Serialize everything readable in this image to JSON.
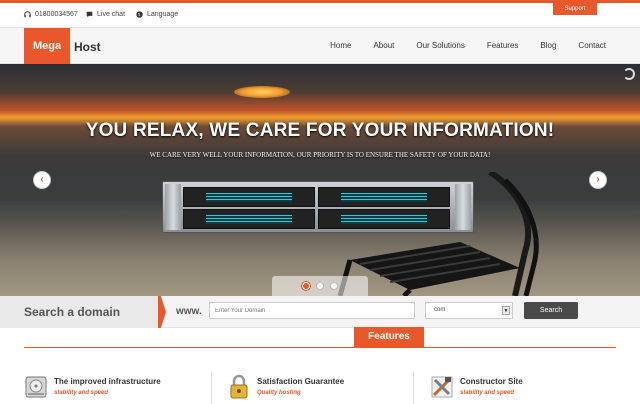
{
  "topbar": {
    "phone": "01800034567",
    "live_chat": "Live chat",
    "language": "Language",
    "support": "Support"
  },
  "logo": {
    "mega": "Mega",
    "host": "Host"
  },
  "nav": {
    "items": [
      "Home",
      "About",
      "Our Solutions",
      "Features",
      "Blog",
      "Contact"
    ]
  },
  "hero": {
    "headline": "YOU RELAX, WE CARE FOR YOUR INFORMATION!",
    "subline": "WE CARE VERY WELL YOUR INFORMATION, OUR PRIORITY IS TO ENSURE THE SAFETY OF YOUR DATA!",
    "prev": "‹",
    "next": "›"
  },
  "domain": {
    "title": "Search a domain",
    "www": "www.",
    "placeholder": "Enter Your Domain",
    "tld": "com",
    "button": "Search"
  },
  "features": {
    "heading": "Features",
    "items": [
      {
        "title": "The improved infrastructure",
        "subtitle": "stability and speed",
        "icon": "hard-drive-icon"
      },
      {
        "title": "Satisfaction Guarantee",
        "subtitle": "Quality hosting",
        "icon": "padlock-icon"
      },
      {
        "title": "Constructor Site",
        "subtitle": "stability and speed",
        "icon": "tools-icon"
      }
    ]
  },
  "colors": {
    "accent": "#e8582a",
    "dark_button": "#4a4a4a"
  }
}
